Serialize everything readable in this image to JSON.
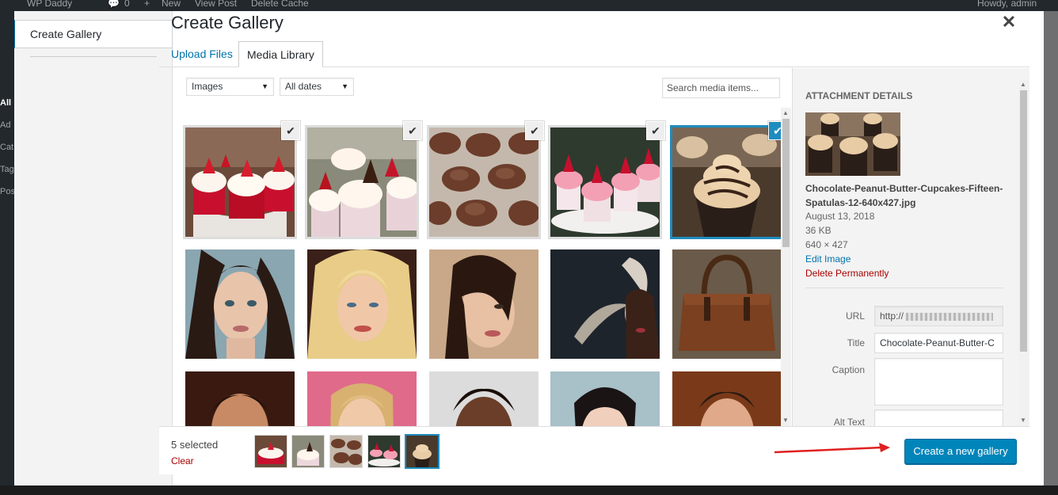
{
  "adminbar": {
    "site": "WP Daddy",
    "comments": "0",
    "new": "New",
    "view_post": "View Post",
    "delete_cache": "Delete Cache",
    "howdy": "Howdy, admin"
  },
  "wpmenu": {
    "items": [
      "All",
      "Ad",
      "Cat",
      "Tag",
      "Pos"
    ]
  },
  "modal": {
    "sidebar_item": "Create Gallery",
    "title": "Create Gallery",
    "close_icon": "close-icon"
  },
  "tabs": {
    "upload": "Upload Files",
    "media": "Media Library"
  },
  "filters": {
    "type": "Images",
    "date": "All dates",
    "search_placeholder": "Search media items..."
  },
  "grid": {
    "items": [
      {
        "label": "strawberry cupcakes on stand",
        "selected": true
      },
      {
        "label": "chocolate strawberry cupcakes",
        "selected": true
      },
      {
        "label": "chocolate frosted cupcakes",
        "selected": true
      },
      {
        "label": "pink strawberry cupcakes",
        "selected": true
      },
      {
        "label": "chocolate peanut butter cupcake",
        "selected": true
      },
      {
        "label": "portrait brunette woman",
        "selected": false
      },
      {
        "label": "portrait blonde woman",
        "selected": false
      },
      {
        "label": "portrait woman hair over face",
        "selected": false
      },
      {
        "label": "woman with horns artwork",
        "selected": false
      },
      {
        "label": "brown leather bag",
        "selected": false
      },
      {
        "label": "portrait smiling man",
        "selected": false
      },
      {
        "label": "portrait blonde girl pink wall",
        "selected": false
      },
      {
        "label": "portrait smiling woman",
        "selected": false
      },
      {
        "label": "portrait asian woman",
        "selected": false
      },
      {
        "label": "portrait smiling man suit",
        "selected": false
      }
    ]
  },
  "details": {
    "heading": "Attachment Details",
    "filename": "Chocolate-Peanut-Butter-Cupcakes-Fifteen-Spatulas-12-640x427.jpg",
    "date": "August 13, 2018",
    "size": "36 KB",
    "dimensions": "640 × 427",
    "edit": "Edit Image",
    "delete": "Delete Permanently",
    "url_label": "URL",
    "url_value": "http://",
    "title_label": "Title",
    "title_value": "Chocolate-Peanut-Butter-C",
    "caption_label": "Caption",
    "alt_label": "Alt Text"
  },
  "footer": {
    "count": "5 selected",
    "clear": "Clear",
    "button": "Create a new gallery"
  },
  "colors": {
    "accent": "#0073aa",
    "button": "#0085ba",
    "selected_outline": "#1e8cbe",
    "delete": "#a00000",
    "arrow": "#e02020"
  }
}
